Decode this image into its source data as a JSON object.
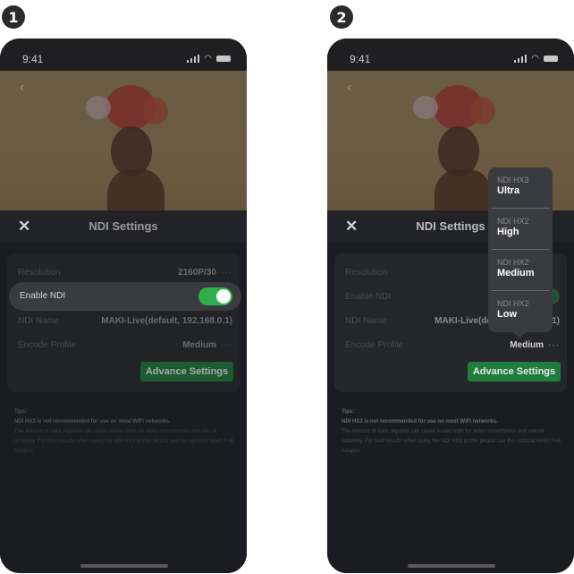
{
  "badges": [
    "1",
    "2"
  ],
  "status": {
    "time": "9:41"
  },
  "header": {
    "title": "NDI Settings"
  },
  "settings": {
    "resolution_label": "Resolution",
    "resolution_value": "2160P/30",
    "enable_label": "Enable NDI",
    "name_label": "NDI Name",
    "name_value": "MAKI-Live(default, 192.168.0.1)",
    "name_value_trunc": "MAKI-Live(de",
    "name_value_tail": "1)",
    "encode_label": "Encode Profile",
    "encode_value": "Medium",
    "more": "···",
    "advance_button": "Advance Settings"
  },
  "tips": {
    "heading": "Tips:",
    "bold": "NDI HX3 is not recommended for use on most WiFi networks.",
    "body": "The amount of data required can cause issues both for video smoothness and overall reliability. For best results when using the NDI HX3 profile please use the optional MAKI PoE Adapter."
  },
  "dropdown": [
    {
      "sub": "NDI HX3",
      "main": "Ultra"
    },
    {
      "sub": "NDI HX2",
      "main": "High"
    },
    {
      "sub": "NDI HX2",
      "main": "Medium"
    },
    {
      "sub": "NDI HX2",
      "main": "Low"
    }
  ],
  "colors": {
    "accent_green": "#2fae4b",
    "button_green": "#1c6d35",
    "background": "#1d1e21"
  },
  "icons": [
    "back-icon",
    "signal-icon",
    "wifi-icon",
    "battery-icon",
    "close-icon"
  ]
}
